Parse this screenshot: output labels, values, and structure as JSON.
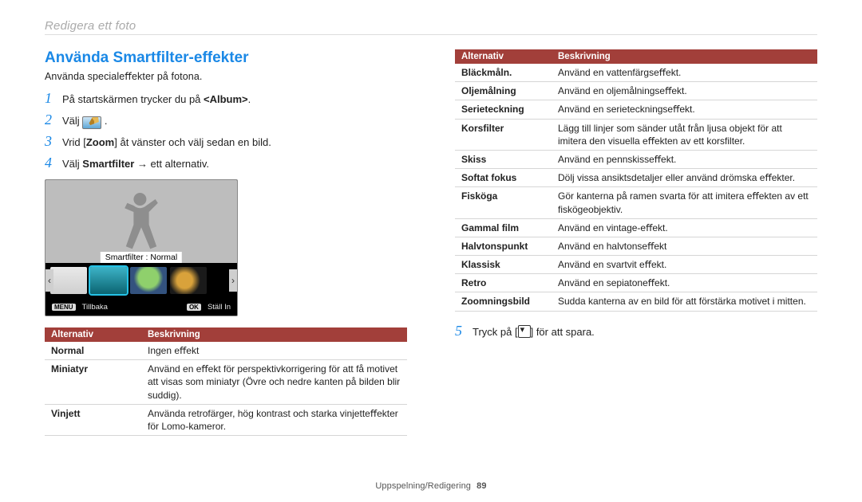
{
  "breadcrumb": "Redigera ett foto",
  "section": {
    "title": "Använda Smartfilter-effekter",
    "subtitle": "Använda specialeﬀekter på fotona."
  },
  "steps": {
    "s1_pre": "På startskärmen trycker du på ",
    "s1_bold": "<Album>",
    "s1_post": ".",
    "s2": "Välj ",
    "s2_post": ".",
    "s3_pre": "Vrid [",
    "s3_bold": "Zoom",
    "s3_post": "] åt vänster och välj sedan en bild.",
    "s4_pre": "Välj ",
    "s4_bold": "Smartfilter",
    "s4_post": " → ett alternativ.",
    "s5_pre": "Tryck på [",
    "s5_post": "] för att spara."
  },
  "device": {
    "label": "Smartﬁlter : Normal",
    "menu_key": "MENU",
    "menu_label": "Tillbaka",
    "ok_key": "OK",
    "ok_label": "Ställ In"
  },
  "table_header": {
    "opt": "Alternativ",
    "desc": "Beskrivning"
  },
  "table_left": [
    {
      "opt": "Normal",
      "desc": "Ingen eﬀekt"
    },
    {
      "opt": "Miniatyr",
      "desc": "Använd en eﬀekt för perspektivkorrigering för att få motivet att visas som miniatyr (Övre och nedre kanten på bilden blir suddig)."
    },
    {
      "opt": "Vinjett",
      "desc": "Använda retrofärger, hög kontrast och starka vinjetteﬀekter för Lomo-kameror."
    }
  ],
  "table_right": [
    {
      "opt": "Bläckmåln.",
      "desc": "Använd en vattenfärgseﬀekt."
    },
    {
      "opt": "Oljemålning",
      "desc": "Använd en oljemålningseﬀekt."
    },
    {
      "opt": "Serieteckning",
      "desc": "Använd en serieteckningseﬀekt."
    },
    {
      "opt": "Korsfilter",
      "desc": "Lägg till linjer som sänder utåt från ljusa objekt för att imitera den visuella eﬀekten av ett korsﬁlter."
    },
    {
      "opt": "Skiss",
      "desc": "Använd en pennskisseﬀekt."
    },
    {
      "opt": "Softat fokus",
      "desc": "Dölj vissa ansiktsdetaljer eller använd drömska eﬀekter."
    },
    {
      "opt": "Fisköga",
      "desc": "Gör kanterna på ramen svarta för att imitera eﬀekten av ett ﬁskögeobjektiv."
    },
    {
      "opt": "Gammal film",
      "desc": "Använd en vintage-eﬀekt."
    },
    {
      "opt": "Halvtonspunkt",
      "desc": "Använd en halvtonseﬀekt"
    },
    {
      "opt": "Klassisk",
      "desc": "Använd en svartvit eﬀekt."
    },
    {
      "opt": "Retro",
      "desc": "Använd en sepiatoneﬀekt."
    },
    {
      "opt": "Zoomningsbild",
      "desc": "Sudda kanterna av en bild för att förstärka motivet i mitten."
    }
  ],
  "footer": {
    "section": "Uppspelning/Redigering",
    "page": "89"
  }
}
